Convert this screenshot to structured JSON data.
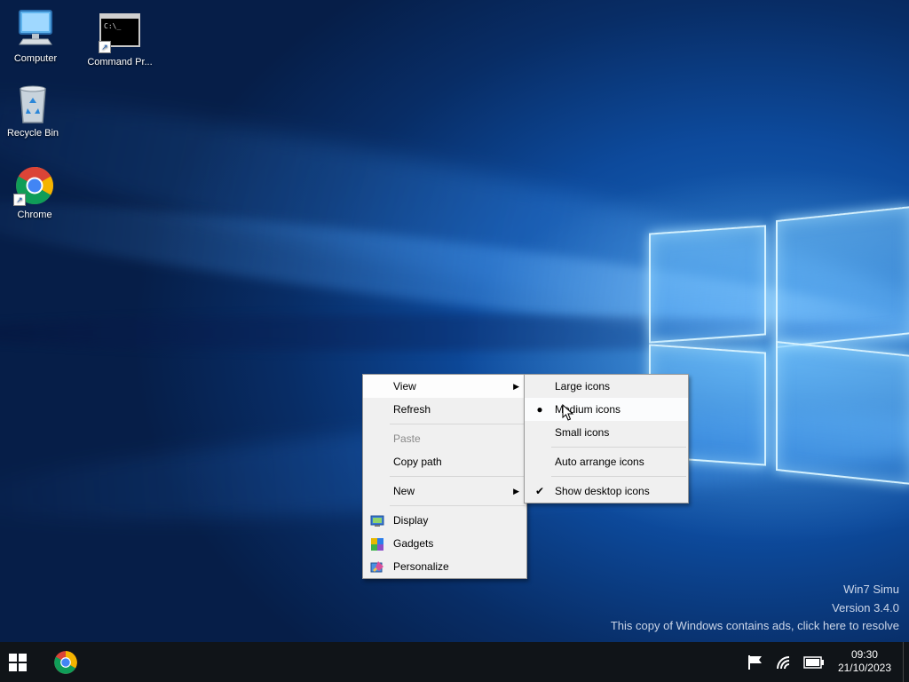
{
  "desktop": {
    "icons": [
      {
        "label": "Computer"
      },
      {
        "label": "Command Pr..."
      },
      {
        "label": "Recycle Bin"
      },
      {
        "label": "Chrome"
      }
    ]
  },
  "context_menu": {
    "items": [
      {
        "label": "View",
        "has_submenu": true
      },
      {
        "label": "Refresh"
      },
      {
        "label": "Paste",
        "disabled": true
      },
      {
        "label": "Copy path"
      },
      {
        "label": "New",
        "has_submenu": true
      },
      {
        "label": "Display",
        "icon": "display-icon"
      },
      {
        "label": "Gadgets",
        "icon": "gadgets-icon"
      },
      {
        "label": "Personalize",
        "icon": "personalize-icon"
      }
    ]
  },
  "view_submenu": {
    "items": [
      {
        "label": "Large icons"
      },
      {
        "label": "Medium icons",
        "selected": true
      },
      {
        "label": "Small icons"
      },
      {
        "label": "Auto arrange icons"
      },
      {
        "label": "Show desktop icons",
        "checked": true
      }
    ]
  },
  "watermark": {
    "line1": "Win7 Simu",
    "line2": "Version 3.4.0",
    "line3": "This copy of Windows contains ads, click here to resolve"
  },
  "taskbar": {
    "time": "09:30",
    "date": "21/10/2023",
    "pinned": [
      "chrome-icon"
    ],
    "tray_icons": [
      "flag-icon",
      "wifi-icon",
      "battery-icon"
    ]
  },
  "colors": {
    "taskbar_bg": "#101418",
    "menu_bg": "#f0f0f0",
    "wallpaper_blue": "#0d4a9c"
  }
}
